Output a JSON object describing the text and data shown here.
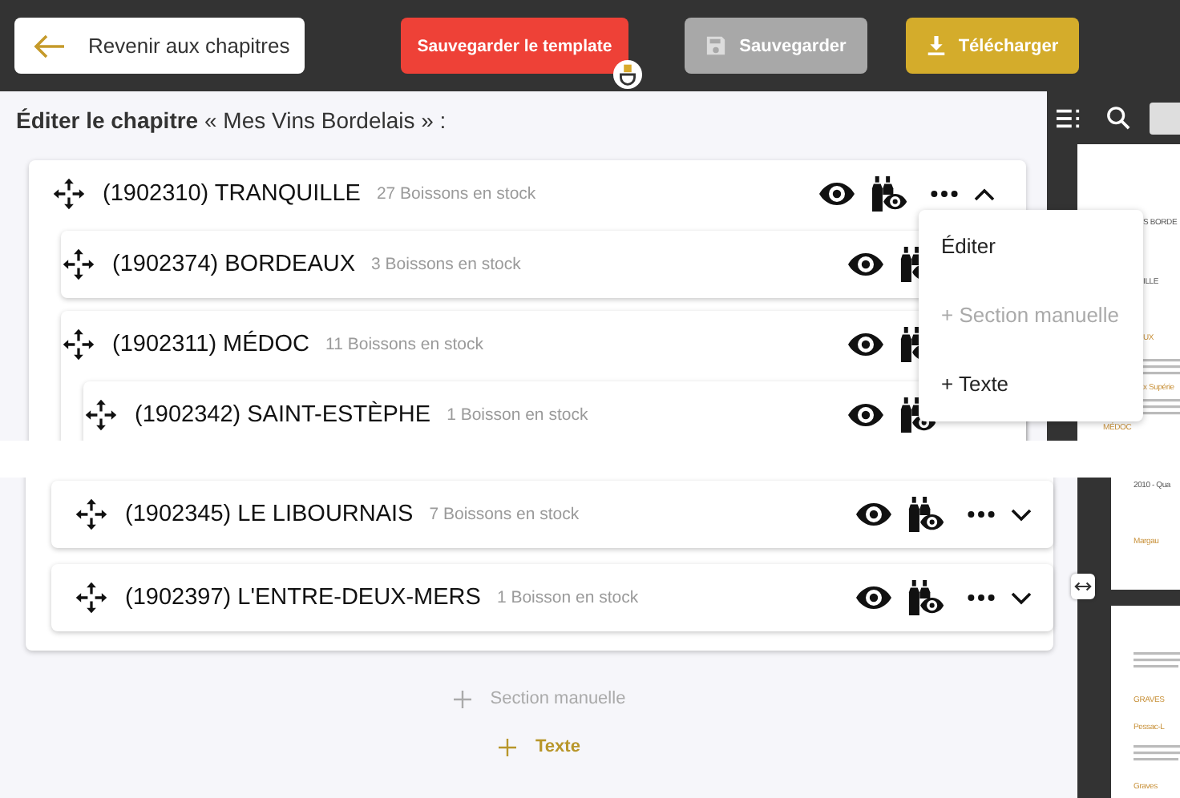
{
  "toolbar": {
    "back_button": "Revenir aux chapitres",
    "template_button": "Sauvegarder le template",
    "save_button": {
      "label": "Sauvegarder",
      "disabled": true
    },
    "download_button": "Télécharger"
  },
  "upper_view": {
    "heading": "**Éditer le chapitre** « Mes Vins Bordelais » :",
    "sections": [
      {
        "title": "(1902310) TRANQUILLE",
        "stock": "27 Boissons en stock",
        "expanded": true,
        "children": [
          {
            "title": "(1902374) BORDEAUX",
            "stock": "3 Boissons en stock"
          },
          {
            "title": "(1902311) MÉDOC",
            "stock": "11 Boissons en stock",
            "children": [
              {
                "title": "(1902342) SAINT-ESTÈPHE",
                "stock": "1 Boisson en stock"
              }
            ]
          }
        ]
      }
    ],
    "menu": [
      {
        "label": "Éditer",
        "disabled": false
      },
      {
        "label": "+ Section manuelle",
        "disabled": true
      },
      {
        "label": "+ Texte",
        "disabled": false
      }
    ],
    "preview": [
      {
        "items": [
          {
            "kind": "heading",
            "text": "S BORDE"
          },
          {
            "kind": "heading",
            "text": "ILLE"
          },
          {
            "kind": "link",
            "text": "UX"
          },
          {
            "kind": "fine_print"
          },
          {
            "kind": "link",
            "text": "x Supérie"
          },
          {
            "kind": "fine_print"
          },
          {
            "kind": "link",
            "text": "MÉDOC"
          }
        ]
      }
    ]
  },
  "lower_view": {
    "sections": [
      {
        "title": "(1902345) LE LIBOURNAIS",
        "stock": "7 Boissons en stock",
        "expanded": false
      },
      {
        "title": "(1902397) L'ENTRE-DEUX-MERS",
        "stock": "1 Boisson en stock",
        "expanded": false
      }
    ],
    "add_section": {
      "label": "Section manuelle",
      "disabled": true
    },
    "add_text": {
      "label": "Texte",
      "disabled": false
    },
    "preview": [
      {
        "items": [
          {
            "kind": "heading",
            "text": "2010 - Qua"
          },
          {
            "kind": "link",
            "text": "Margau"
          }
        ]
      },
      {
        "items": [
          {
            "kind": "fine_print"
          },
          {
            "kind": "link",
            "text": "GRAVES"
          },
          {
            "kind": "link",
            "text": "Pessac-L"
          },
          {
            "kind": "fine_print"
          },
          {
            "kind": "link",
            "text": "Graves"
          }
        ]
      }
    ]
  }
}
